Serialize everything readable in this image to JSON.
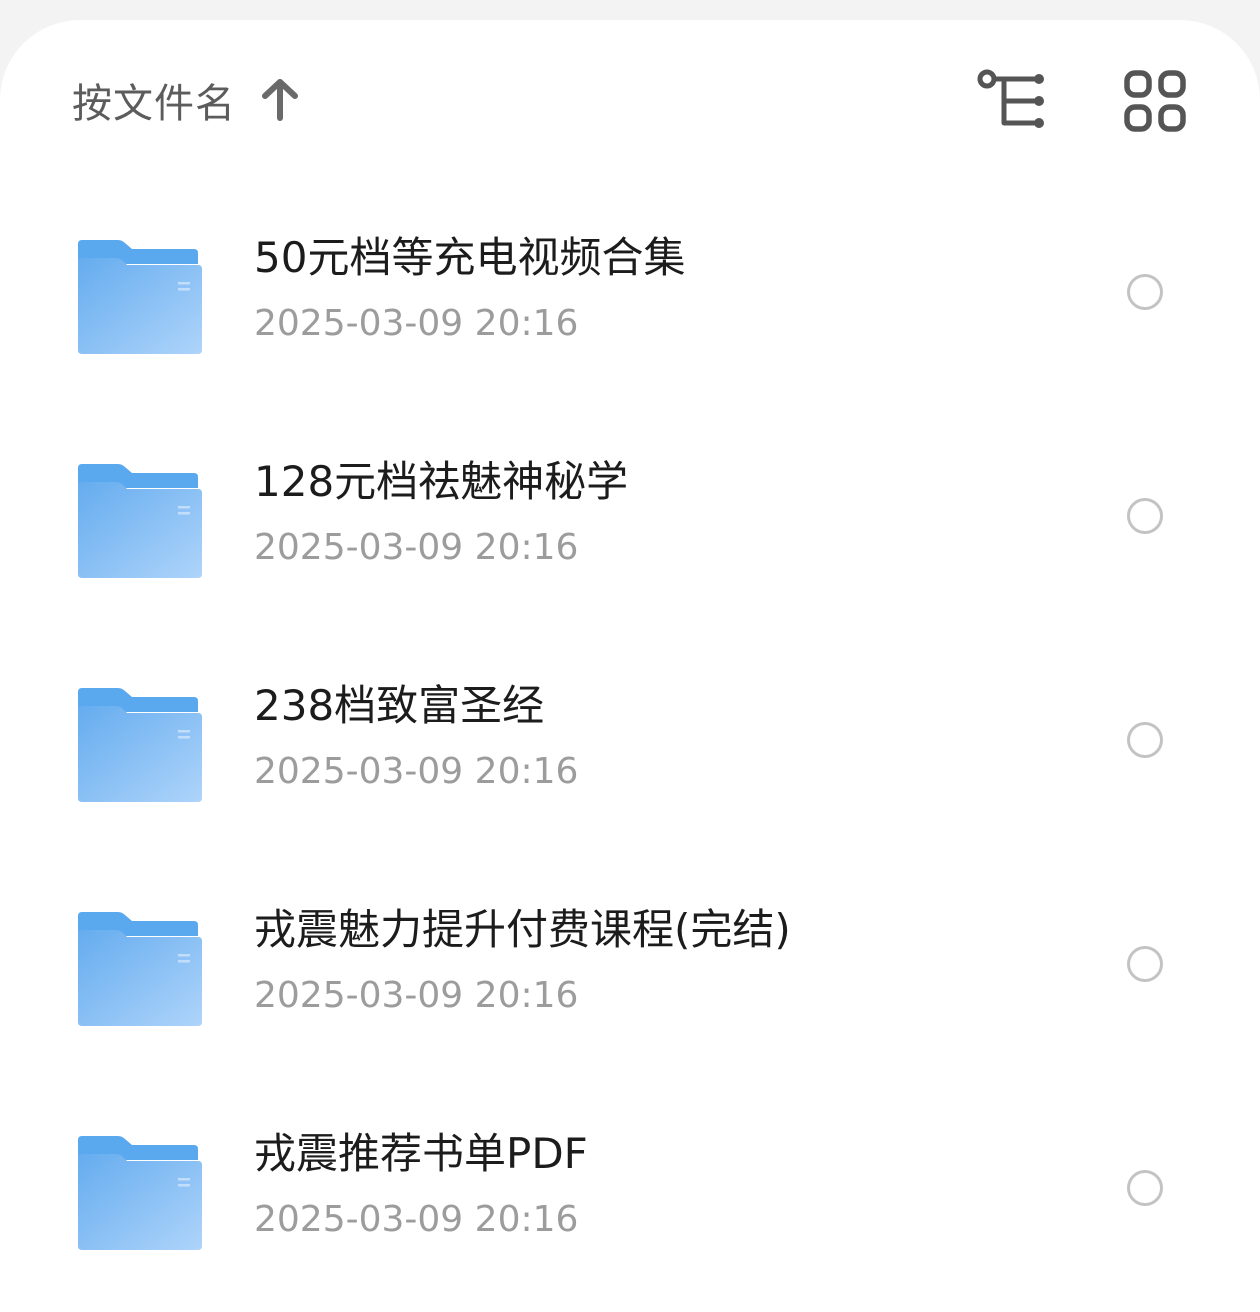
{
  "toolbar": {
    "sort_label": "按文件名",
    "sort_direction_icon": "arrow-up-icon",
    "tree_view_icon": "tree-view-icon",
    "grid_view_icon": "grid-view-icon"
  },
  "colors": {
    "folder_tab": "#5aa8ee",
    "folder_body_start": "#65acef",
    "folder_body_end": "#aed4fa",
    "text_primary": "#1c1c1c",
    "text_secondary": "#9c9c9c",
    "radio_border": "#c3c3c3"
  },
  "files": [
    {
      "name": "50元档等充电视频合集",
      "date": "2025-03-09 20:16",
      "type": "folder-icon",
      "selected": false
    },
    {
      "name": "128元档祛魅神秘学",
      "date": "2025-03-09 20:16",
      "type": "folder-icon",
      "selected": false
    },
    {
      "name": "238档致富圣经",
      "date": "2025-03-09 20:16",
      "type": "folder-icon",
      "selected": false
    },
    {
      "name": "戎震魅力提升付费课程(完结)",
      "date": "2025-03-09 20:16",
      "type": "folder-icon",
      "selected": false
    },
    {
      "name": "戎震推荐书单PDF",
      "date": "2025-03-09 20:16",
      "type": "folder-icon",
      "selected": false
    }
  ]
}
